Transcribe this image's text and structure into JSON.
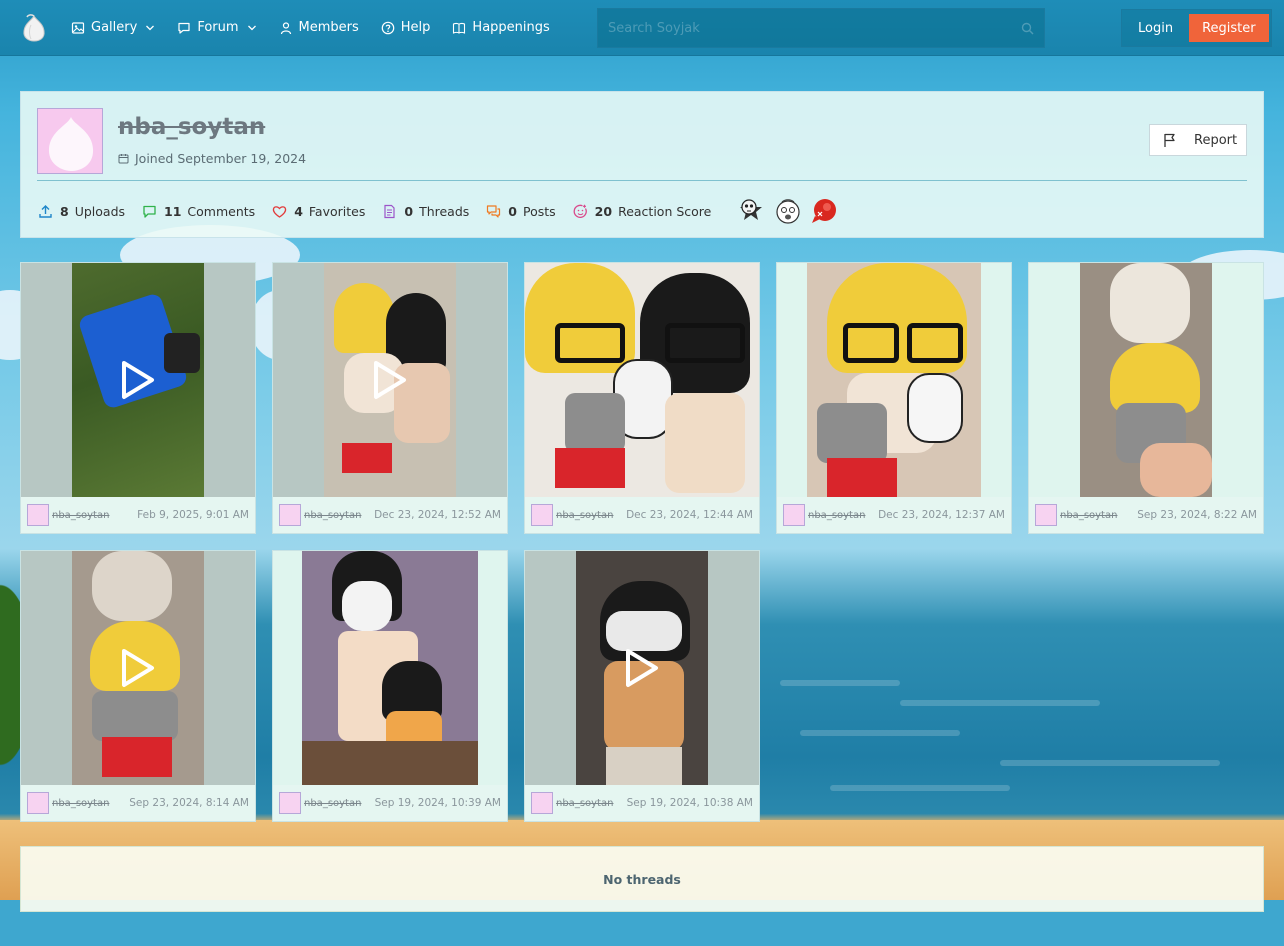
{
  "nav": {
    "items": [
      {
        "label": "Gallery",
        "icon": "image-icon",
        "dropdown": true
      },
      {
        "label": "Forum",
        "icon": "chat-bubble-icon",
        "dropdown": true
      },
      {
        "label": "Members",
        "icon": "user-icon",
        "dropdown": false
      },
      {
        "label": "Help",
        "icon": "question-circle-icon",
        "dropdown": false
      },
      {
        "label": "Happenings",
        "icon": "book-icon",
        "dropdown": false
      }
    ],
    "search_placeholder": "Search Soyjak",
    "login_label": "Login",
    "register_label": "Register"
  },
  "profile": {
    "username": "nba_soytan",
    "joined": "Joined September 19, 2024",
    "report_label": "Report",
    "stats": [
      {
        "value": "8",
        "label": "Uploads",
        "icon": "upload-icon",
        "color": "#1f86c9"
      },
      {
        "value": "11",
        "label": "Comments",
        "icon": "comment-icon",
        "color": "#2fb24a"
      },
      {
        "value": "4",
        "label": "Favorites",
        "icon": "heart-icon",
        "color": "#e23b3b"
      },
      {
        "value": "0",
        "label": "Threads",
        "icon": "document-icon",
        "color": "#9c54c9"
      },
      {
        "value": "0",
        "label": "Posts",
        "icon": "posts-icon",
        "color": "#ef7a22"
      },
      {
        "value": "20",
        "label": "Reaction Score",
        "icon": "reaction-icon",
        "color": "#d94a8c"
      }
    ],
    "badges": [
      "skull-badge",
      "soyjak-face-badge",
      "red-speech-badge"
    ]
  },
  "gallery": [
    {
      "user": "nba_soytan",
      "date": "Feb 9, 2025, 9:01 AM",
      "video": true
    },
    {
      "user": "nba_soytan",
      "date": "Dec 23, 2024, 12:52 AM",
      "video": true
    },
    {
      "user": "nba_soytan",
      "date": "Dec 23, 2024, 12:44 AM",
      "video": false
    },
    {
      "user": "nba_soytan",
      "date": "Dec 23, 2024, 12:37 AM",
      "video": false
    },
    {
      "user": "nba_soytan",
      "date": "Sep 23, 2024, 8:22 AM",
      "video": false
    },
    {
      "user": "nba_soytan",
      "date": "Sep 23, 2024, 8:14 AM",
      "video": true
    },
    {
      "user": "nba_soytan",
      "date": "Sep 19, 2024, 10:39 AM",
      "video": false
    },
    {
      "user": "nba_soytan",
      "date": "Sep 19, 2024, 10:38 AM",
      "video": true
    }
  ],
  "threads_empty": "No threads"
}
